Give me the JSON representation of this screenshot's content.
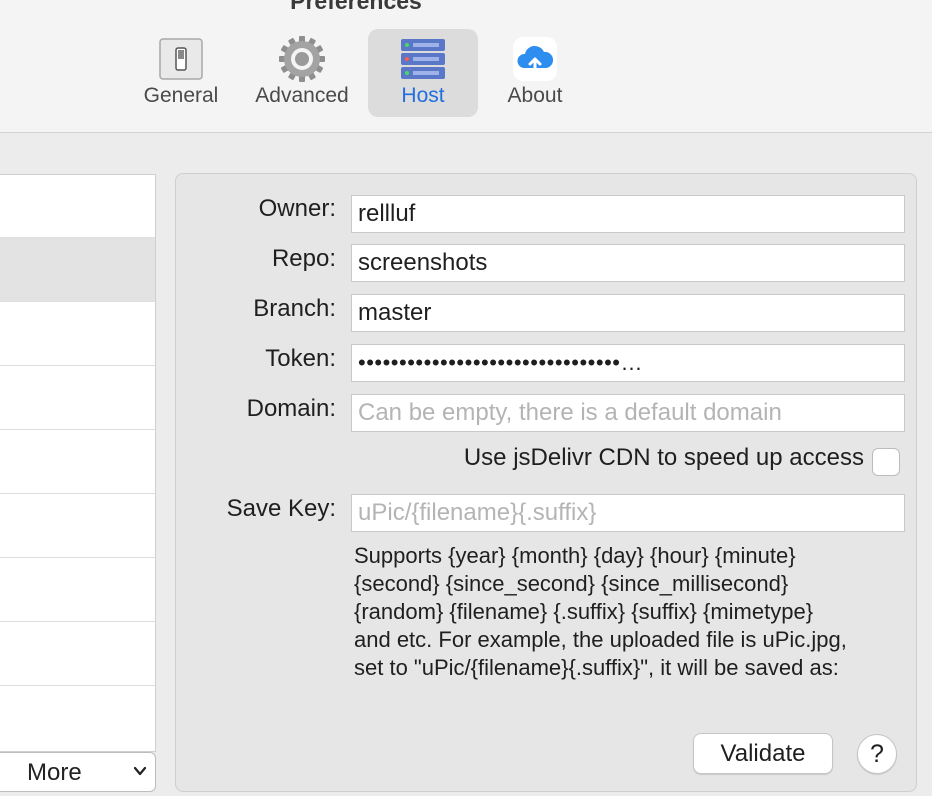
{
  "window": {
    "title": "Preferences"
  },
  "toolbar": {
    "items": [
      {
        "label": "General",
        "icon": "switch-icon",
        "selected": false
      },
      {
        "label": "Advanced",
        "icon": "gear-icon",
        "selected": false
      },
      {
        "label": "Host",
        "icon": "server-icon",
        "selected": true
      },
      {
        "label": "About",
        "icon": "cloud-upload-icon",
        "selected": false
      }
    ]
  },
  "host_list": {
    "selected_row": 1,
    "more_label": "More"
  },
  "form": {
    "owner_label": "Owner:",
    "owner_value": "rellluf",
    "repo_label": "Repo:",
    "repo_value": "screenshots",
    "branch_label": "Branch:",
    "branch_value": "master",
    "token_label": "Token:",
    "token_value": "••••••••••••••••••••••••••••••••…",
    "domain_label": "Domain:",
    "domain_placeholder": "Can be empty, there is a default domain",
    "cdn_label": "Use jsDelivr CDN to speed up access",
    "cdn_checked": false,
    "savekey_label": "Save Key:",
    "savekey_placeholder": "uPic/{filename}{.suffix}",
    "help_lines": [
      "Supports {year} {month} {day} {hour} {minute}",
      "{second} {since_second} {since_millisecond}",
      "{random} {filename} {.suffix} {suffix} {mimetype}",
      "and etc. For example, the uploaded file is uPic.jpg,",
      "set to \"uPic/{filename}{.suffix}\", it will be saved as:"
    ],
    "validate_label": "Validate",
    "help_button_label": "?"
  },
  "colors": {
    "accent": "#1f6fe0",
    "selected_tab_bg": "#dcdcdc"
  }
}
